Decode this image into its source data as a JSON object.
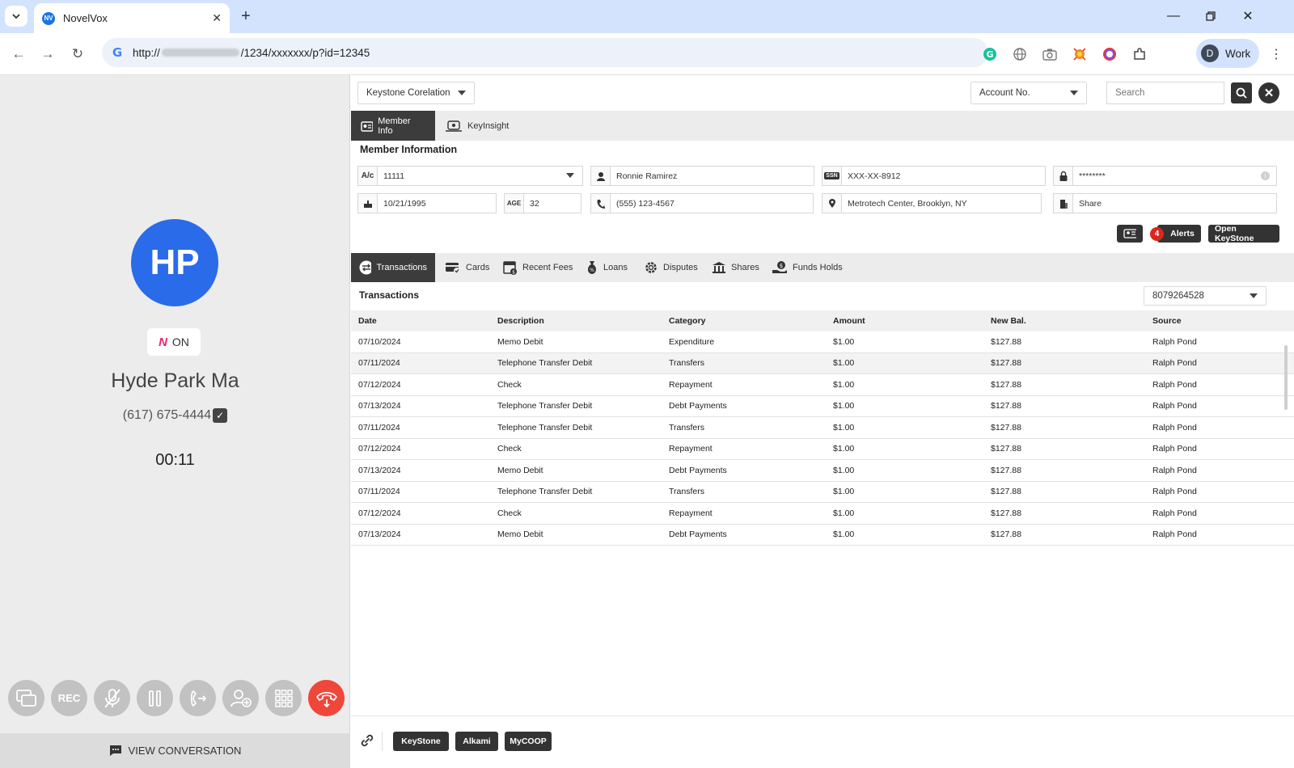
{
  "browser": {
    "tab_title": "NovelVox",
    "url_prefix": "http://",
    "url_suffix": "/1234/xxxxxxx/p?id=12345",
    "profile_initial": "D",
    "profile_name": "Work"
  },
  "call": {
    "avatar_initials": "HP",
    "ai_status": "ON",
    "caller_name": "Hyde Park Ma",
    "caller_phone": "(617) 675-4444",
    "timer": "00:11",
    "rec_label": "REC",
    "view_conversation": "VIEW CONVERSATION",
    "hangup_color": "#f0473b"
  },
  "crm": {
    "org_select": "Keystone Corelation",
    "search_type": "Account No.",
    "search_placeholder": "Search",
    "tabs": [
      "Member Info",
      "KeyInsight"
    ],
    "member_section_title": "Member Information",
    "member": {
      "account_label": "A/c",
      "account": "11111",
      "name": "Ronnie Ramirez",
      "ssn_label": "SSN",
      "ssn": "XXX-XX-8912",
      "password": "********",
      "dob": "10/21/1995",
      "age_label": "AGE",
      "age": "32",
      "phone": "(555) 123-4567",
      "address": "Metrotech Center, Brooklyn, NY",
      "share": "Share"
    },
    "alerts_count": "4",
    "alerts_label": "Alerts",
    "open_keystone_label": "Open KeyStone",
    "tx_tabs": [
      "Transactions",
      "Cards",
      "Recent Fees",
      "Loans",
      "Disputes",
      "Shares",
      "Funds Holds"
    ],
    "transactions_title": "Transactions",
    "transactions_account": "8079264528",
    "columns": [
      "Date",
      "Description",
      "Category",
      "Amount",
      "New Bal.",
      "Source"
    ],
    "rows": [
      [
        "07/10/2024",
        "Memo Debit",
        "Expenditure",
        "$1.00",
        "$127.88",
        "Ralph Pond"
      ],
      [
        "07/11/2024",
        "Telephone Transfer Debit",
        "Transfers",
        "$1.00",
        "$127.88",
        "Ralph Pond"
      ],
      [
        "07/12/2024",
        "Check",
        "Repayment",
        "$1.00",
        "$127.88",
        "Ralph Pond"
      ],
      [
        "07/13/2024",
        "Telephone Transfer Debit",
        "Debt Payments",
        "$1.00",
        "$127.88",
        "Ralph Pond"
      ],
      [
        "07/11/2024",
        "Telephone Transfer Debit",
        "Transfers",
        "$1.00",
        "$127.88",
        "Ralph Pond"
      ],
      [
        "07/12/2024",
        "Check",
        "Repayment",
        "$1.00",
        "$127.88",
        "Ralph Pond"
      ],
      [
        "07/13/2024",
        "Memo Debit",
        "Debt Payments",
        "$1.00",
        "$127.88",
        "Ralph Pond"
      ],
      [
        "07/11/2024",
        "Telephone Transfer Debit",
        "Transfers",
        "$1.00",
        "$127.88",
        "Ralph Pond"
      ],
      [
        "07/12/2024",
        "Check",
        "Repayment",
        "$1.00",
        "$127.88",
        "Ralph Pond"
      ],
      [
        "07/13/2024",
        "Memo Debit",
        "Debt Payments",
        "$1.00",
        "$127.88",
        "Ralph Pond"
      ]
    ],
    "footer_links": [
      "KeyStone",
      "Alkami",
      "MyCOOP"
    ]
  }
}
